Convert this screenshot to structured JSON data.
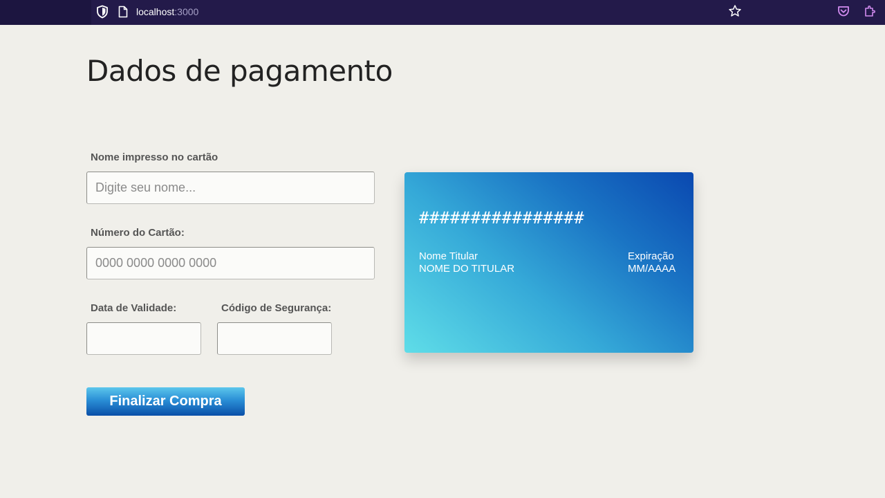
{
  "browser": {
    "url_host": "localhost",
    "url_port": ":3000",
    "icons": [
      "shield-icon",
      "page-icon",
      "star-icon",
      "pocket-icon",
      "extensions-icon"
    ]
  },
  "page": {
    "title": "Dados de pagamento"
  },
  "form": {
    "name_label": "Nome impresso no cartão",
    "name_placeholder": "Digite seu nome...",
    "name_value": "",
    "number_label": "Número do Cartão:",
    "number_placeholder": "0000 0000 0000 0000",
    "number_value": "",
    "expiry_label": "Data de Validade:",
    "expiry_value": "",
    "cvv_label": "Código de Segurança:",
    "cvv_value": "",
    "submit_label": "Finalizar Compra"
  },
  "card": {
    "number": "################",
    "holder_label": "Nome Titular",
    "holder_value": "NOME DO TITULAR",
    "expiry_label": "Expiração",
    "expiry_value": "MM/AAAA",
    "colors": {
      "gradient_start": "#5fdde8",
      "gradient_end": "#0a48b0"
    }
  },
  "colors": {
    "browser_bar": "#231a4a",
    "page_background": "#f0efea",
    "button_top": "#5cc6ec",
    "button_bottom": "#0a4fa8"
  }
}
